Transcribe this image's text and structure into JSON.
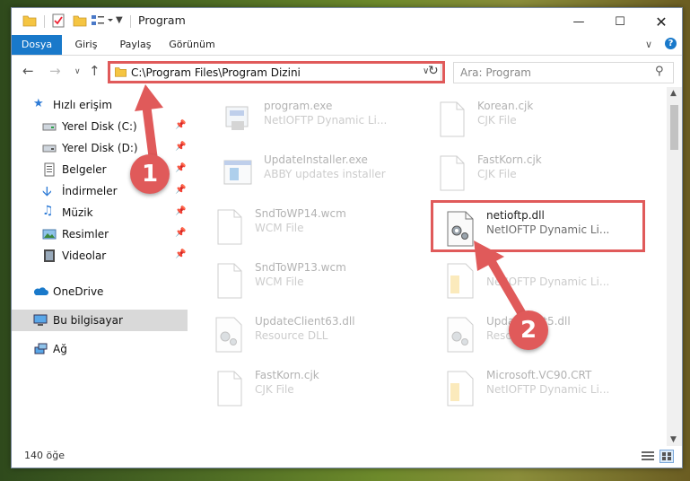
{
  "window": {
    "title": "Program"
  },
  "ribbon": {
    "tabs": [
      "Dosya",
      "Giriş",
      "Paylaş",
      "Görünüm"
    ]
  },
  "address": {
    "path": "C:\\Program Files\\Program Dizini"
  },
  "search": {
    "placeholder": "Ara: Program"
  },
  "sidebar": {
    "items": [
      {
        "label": "Hızlı erişim",
        "icon": "star-icon"
      },
      {
        "label": "Yerel Disk (C:)",
        "icon": "drive-icon"
      },
      {
        "label": "Yerel Disk (D:)",
        "icon": "drive-icon"
      },
      {
        "label": "Belgeler",
        "icon": "document-icon"
      },
      {
        "label": "İndirmeler",
        "icon": "download-icon"
      },
      {
        "label": "Müzik",
        "icon": "music-icon"
      },
      {
        "label": "Resimler",
        "icon": "picture-icon"
      },
      {
        "label": "Videolar",
        "icon": "video-icon"
      },
      {
        "label": "OneDrive",
        "icon": "cloud-icon"
      },
      {
        "label": "Bu bilgisayar",
        "icon": "computer-icon"
      },
      {
        "label": "Ağ",
        "icon": "network-icon"
      }
    ]
  },
  "files": [
    {
      "name": "program.exe",
      "desc": "NetIOFTP Dynamic Li...",
      "icon": "exe-icon"
    },
    {
      "name": "Korean.cjk",
      "desc": "CJK File",
      "icon": "file-icon"
    },
    {
      "name": "UpdateInstaller.exe",
      "desc": "ABBY updates installer",
      "icon": "installer-icon"
    },
    {
      "name": "FastKorn.cjk",
      "desc": "CJK File",
      "icon": "file-icon"
    },
    {
      "name": "SndToWP14.wcm",
      "desc": "WCM File",
      "icon": "file-icon"
    },
    {
      "name": "netioftp.dll",
      "desc": "NetIOFTP Dynamic Li...",
      "icon": "dll-gear-icon"
    },
    {
      "name": "SndToWP13.wcm",
      "desc": "WCM File",
      "icon": "file-icon"
    },
    {
      "name": "",
      "desc": "NetIOFTP Dynamic Li...",
      "icon": "dll-folder-icon"
    },
    {
      "name": "UpdateClient63.dll",
      "desc": "Resource DLL",
      "icon": "dll-gear-icon"
    },
    {
      "name": "UpdateC...t5.dll",
      "desc": "Resour...",
      "icon": "dll-gear-icon"
    },
    {
      "name": "FastKorn.cjk",
      "desc": "CJK File",
      "icon": "file-icon"
    },
    {
      "name": "Microsoft.VC90.CRT",
      "desc": "NetIOFTP Dynamic Li...",
      "icon": "dll-folder-icon"
    }
  ],
  "status": {
    "count": "140 öğe"
  },
  "badges": {
    "one": "1",
    "two": "2"
  },
  "colors": {
    "accent": "#1979ca",
    "highlight": "#e05a5a"
  }
}
